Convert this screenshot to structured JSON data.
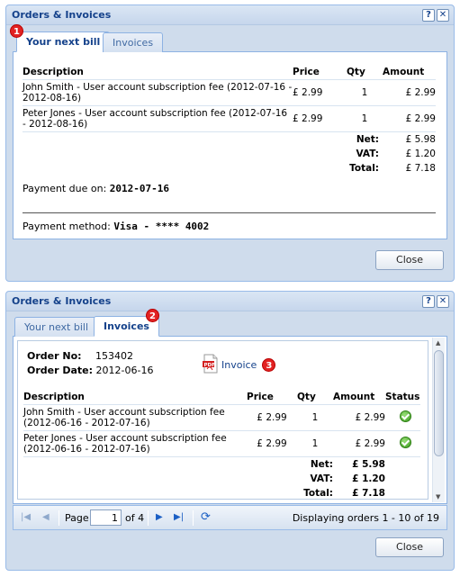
{
  "window1": {
    "title": "Orders & Invoices",
    "help_label": "?",
    "close_label": "✕",
    "tabs": [
      {
        "label": "Your next bill"
      },
      {
        "label": "Invoices"
      }
    ],
    "badge": "1",
    "table": {
      "headers": {
        "description": "Description",
        "price": "Price",
        "qty": "Qty",
        "amount": "Amount"
      },
      "rows": [
        {
          "description": "John Smith - User account subscription fee (2012-07-16 - 2012-08-16)",
          "price": "£ 2.99",
          "qty": "1",
          "amount": "£ 2.99"
        },
        {
          "description": "Peter Jones - User account subscription fee (2012-07-16 - 2012-08-16)",
          "price": "£ 2.99",
          "qty": "1",
          "amount": "£ 2.99"
        }
      ],
      "totals": [
        {
          "label": "Net:",
          "value": "£ 5.98"
        },
        {
          "label": "VAT:",
          "value": "£ 1.20"
        },
        {
          "label": "Total:",
          "value": "£ 7.18"
        }
      ]
    },
    "payment_due_label": "Payment due on:",
    "payment_due_value": "2012-07-16",
    "payment_method_label": "Payment method:",
    "payment_method_value": "Visa - **** 4002",
    "close_button": "Close"
  },
  "window2": {
    "title": "Orders & Invoices",
    "help_label": "?",
    "close_label": "✕",
    "tabs": [
      {
        "label": "Your next bill"
      },
      {
        "label": "Invoices"
      }
    ],
    "badge_tab": "2",
    "badge_invoice": "3",
    "order_no_label": "Order No:",
    "order_no_value": "153402",
    "order_date_label": "Order Date:",
    "order_date_value": "2012-06-16",
    "invoice_link": "Invoice",
    "table": {
      "headers": {
        "description": "Description",
        "price": "Price",
        "qty": "Qty",
        "amount": "Amount",
        "status": "Status"
      },
      "rows": [
        {
          "description": "John Smith - User account subscription fee (2012-06-16 - 2012-07-16)",
          "price": "£ 2.99",
          "qty": "1",
          "amount": "£ 2.99",
          "status": "paid-check-icon"
        },
        {
          "description": "Peter Jones - User account subscription fee (2012-06-16 - 2012-07-16)",
          "price": "£ 2.99",
          "qty": "1",
          "amount": "£ 2.99",
          "status": "paid-check-icon"
        }
      ],
      "totals": [
        {
          "label": "Net:",
          "value": "£ 5.98"
        },
        {
          "label": "VAT:",
          "value": "£ 1.20"
        },
        {
          "label": "Total:",
          "value": "£ 7.18"
        }
      ]
    },
    "pager": {
      "page_label": "Page",
      "page_value": "1",
      "of_label": "of 4",
      "display_text": "Displaying orders 1 - 10 of 19"
    },
    "close_button": "Close"
  }
}
